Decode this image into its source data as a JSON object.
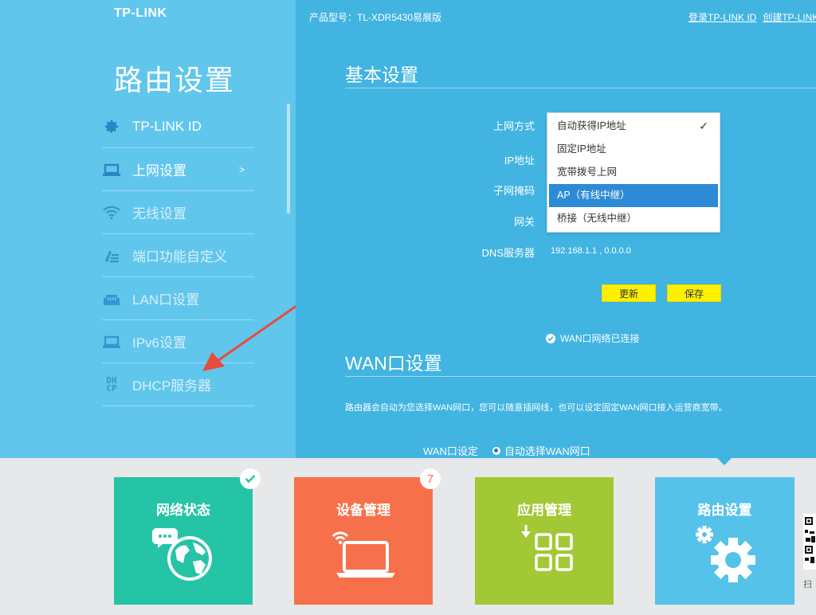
{
  "header": {
    "logo": "TP-LINK",
    "product": "产品型号：TL-XDR5430易展版",
    "links": [
      "登录TP-LINK ID",
      "创建TP-LINK ID"
    ]
  },
  "sidebar": {
    "title": "路由设置",
    "items": [
      {
        "label": "TP-LINK ID",
        "icon": "gear-icon"
      },
      {
        "label": "上网设置",
        "icon": "laptop-icon",
        "arrow": ">"
      },
      {
        "label": "无线设置",
        "icon": "wifi-icon"
      },
      {
        "label": "端口功能自定义",
        "icon": "edit-list-icon"
      },
      {
        "label": "LAN口设置",
        "icon": "lan-port-icon"
      },
      {
        "label": "IPv6设置",
        "icon": "laptop-icon"
      },
      {
        "label": "DHCP服务器",
        "icon": "dhcp-icon",
        "icon_text": "DHCP"
      }
    ]
  },
  "basic": {
    "title": "基本设置",
    "labels": {
      "mode": "上网方式",
      "ip": "IP地址",
      "mask": "子网掩码",
      "gateway": "网关",
      "dns": "DNS服务器"
    },
    "dns_value": "192.168.1.1 , 0.0.0.0",
    "dropdown": {
      "options": [
        "自动获得IP地址",
        "固定IP地址",
        "宽带拨号上网",
        "AP（有线中继）",
        "桥接（无线中继）"
      ],
      "checked_index": 0,
      "highlighted_index": 3,
      "check_glyph": "✓"
    },
    "buttons": {
      "refresh": "更新",
      "save": "保存"
    },
    "wan_status": "WAN口网络已连接"
  },
  "wan": {
    "title": "WAN口设置",
    "description": "路由器会自动为您选择WAN网口，您可以随意插网线，也可以设定固定WAN网口接入运营商宽带。",
    "setting_label": "WAN口设定",
    "setting_value": "自动选择WAN网口"
  },
  "tiles": [
    {
      "label": "网络状态",
      "color": "#25c4a6",
      "icon": "globe-chat-icon",
      "badge": "check"
    },
    {
      "label": "设备管理",
      "color": "#f6714b",
      "icon": "laptop-wifi-icon",
      "badge": "7"
    },
    {
      "label": "应用管理",
      "color": "#a3c835",
      "icon": "apps-grid-icon"
    },
    {
      "label": "路由设置",
      "color": "#55c2ea",
      "icon": "gears-icon"
    }
  ],
  "qr": {
    "text": "扫"
  },
  "colors": {
    "sidebar_bg": "#61c6ec",
    "main_bg": "#41b4e2",
    "button_yellow": "#fff000",
    "highlight_blue": "#2d8ad6",
    "arrow_red": "#e84a3e"
  }
}
